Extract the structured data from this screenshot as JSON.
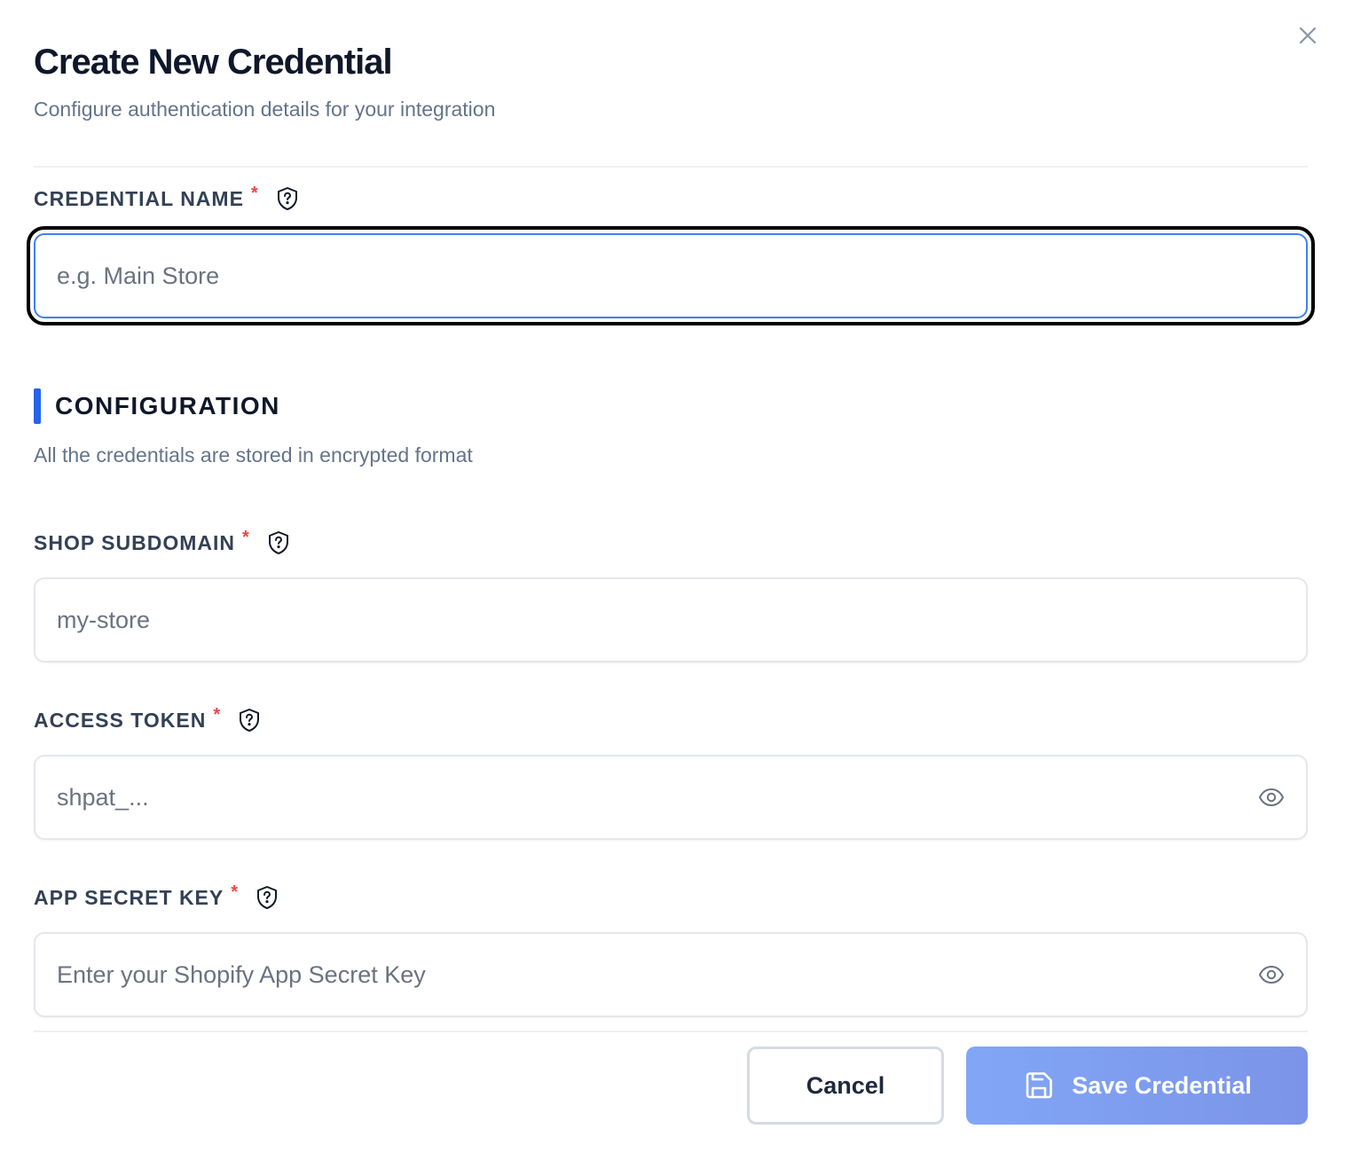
{
  "header": {
    "title": "Create New Credential",
    "subtitle": "Configure authentication details for your integration"
  },
  "credential_name": {
    "label": "CREDENTIAL NAME",
    "required_mark": "*",
    "placeholder": "e.g. Main Store",
    "value": ""
  },
  "configuration": {
    "title": "CONFIGURATION",
    "subtitle": "All the credentials are stored in encrypted format",
    "accent_color": "#2563eb"
  },
  "shop_subdomain": {
    "label": "SHOP SUBDOMAIN",
    "required_mark": "*",
    "placeholder": "my-store",
    "value": ""
  },
  "access_token": {
    "label": "ACCESS TOKEN",
    "required_mark": "*",
    "placeholder": "shpat_...",
    "value": ""
  },
  "app_secret_key": {
    "label": "APP SECRET KEY",
    "required_mark": "*",
    "placeholder": "Enter your Shopify App Secret Key",
    "value": ""
  },
  "footer": {
    "cancel_label": "Cancel",
    "save_label": "Save Credential"
  },
  "icons": {
    "close": "close-icon",
    "help": "shield-question-icon",
    "visibility": "eye-icon",
    "save": "save-icon"
  },
  "colors": {
    "required": "#ef4444",
    "focus_border": "#3b82f6",
    "save_button": "#82a6f6"
  }
}
